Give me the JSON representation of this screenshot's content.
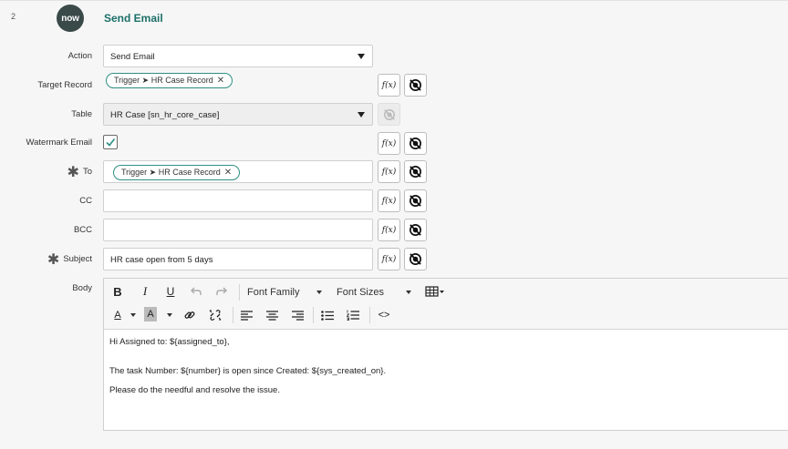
{
  "step": {
    "number": "2",
    "logo_text": "now",
    "title": "Send Email"
  },
  "form": {
    "action": {
      "label": "Action",
      "value": "Send Email"
    },
    "target_record": {
      "label": "Target Record",
      "pill": "Trigger ➤ HR Case Record"
    },
    "table": {
      "label": "Table",
      "value": "HR Case [sn_hr_core_case]"
    },
    "watermark": {
      "label": "Watermark Email",
      "checked": true
    },
    "to": {
      "label": "To",
      "required": "✱",
      "pill": "Trigger ➤ HR Case Record"
    },
    "cc": {
      "label": "CC",
      "value": ""
    },
    "bcc": {
      "label": "BCC",
      "value": ""
    },
    "subject": {
      "label": "Subject",
      "required": "✱",
      "value": "HR case open from 5 days"
    },
    "body": {
      "label": "Body"
    }
  },
  "buttons": {
    "fx_label": "f(x)",
    "pill_remove": "✕"
  },
  "editor": {
    "toolbar": {
      "bold": "B",
      "italic": "I",
      "underline": "U",
      "font_family": "Font Family",
      "font_sizes": "Font Sizes",
      "code": "<>"
    },
    "lines": [
      "Hi Assigned to: ${assigned_to},",
      "",
      "The task Number: ${number} is open since Created: ${sys_created_on}.",
      "Please do the needful and resolve the issue."
    ]
  },
  "colors": {
    "accent": "#1c7068",
    "pill_border": "#2d8f84",
    "logo_bg": "#3a4a49"
  }
}
